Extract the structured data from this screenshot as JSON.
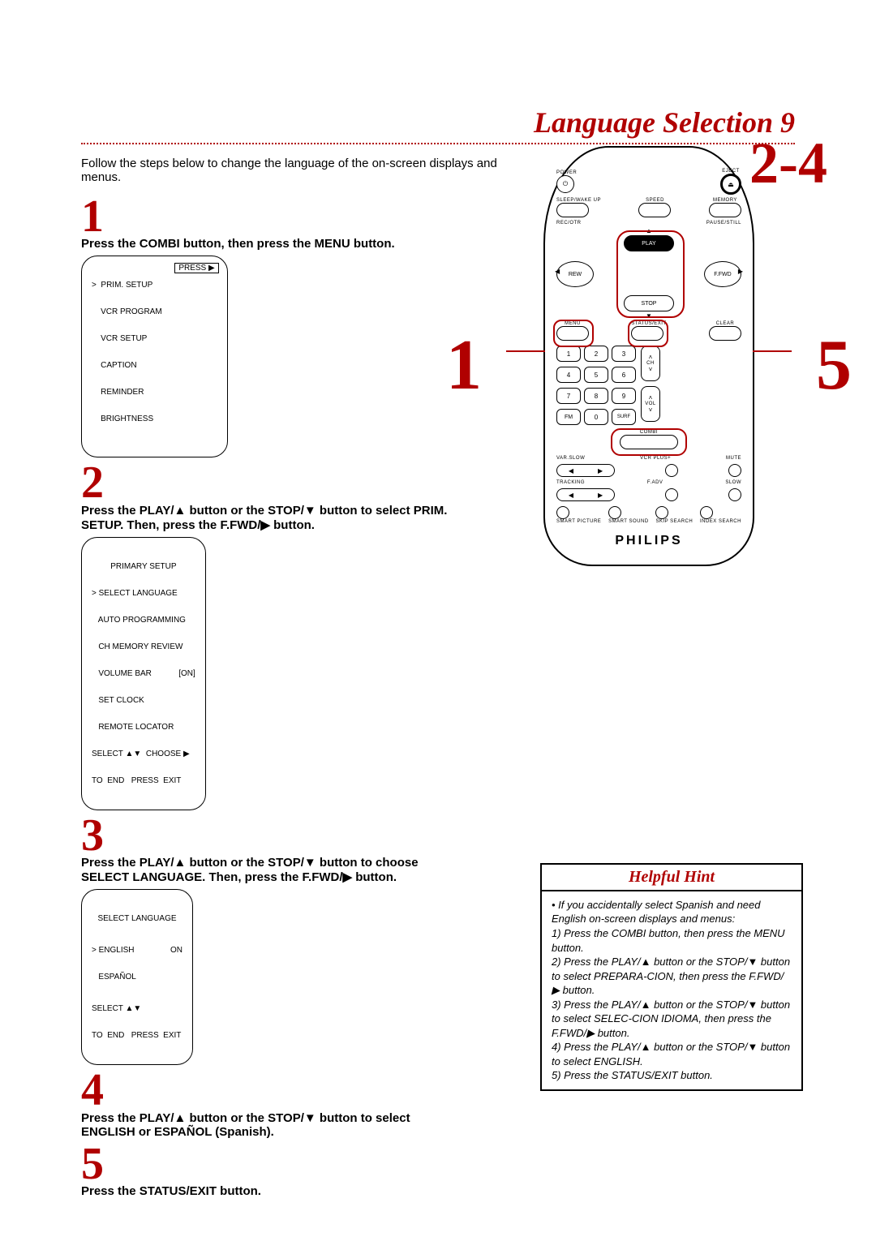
{
  "title": "Language Selection  9",
  "intro": "Follow the steps below to change the language of the on-screen displays and menus.",
  "steps": {
    "1": "Press the COMBI button, then press the MENU button.",
    "2": "Press the PLAY/▲ button or the STOP/▼ button to select PRIM. SETUP. Then, press the F.FWD/▶ button.",
    "3": "Press the PLAY/▲ button or the STOP/▼ button to choose SELECT LANGUAGE. Then, press the F.FWD/▶ button.",
    "4": "Press the PLAY/▲ button or the STOP/▼ button to select ENGLISH or ESPAÑOL (Spanish).",
    "5": "Press the STATUS/EXIT button."
  },
  "osd1": {
    "l1": ">  PRIM. SETUP",
    "l2": "    VCR PROGRAM",
    "l3": "    VCR SETUP",
    "l4": "    CAPTION",
    "l5": "    REMINDER",
    "l6": "    BRIGHTNESS",
    "press": "PRESS ▶"
  },
  "osd2": {
    "hdr": "PRIMARY SETUP",
    "l1": "> SELECT LANGUAGE",
    "l2": "   AUTO PROGRAMMING",
    "l3": "   CH MEMORY REVIEW",
    "l4": "   VOLUME BAR            [ON]",
    "l5": "   SET CLOCK",
    "l6": "   REMOTE LOCATOR",
    "f1": "SELECT ▲▼  CHOOSE ▶",
    "f2": "TO  END   PRESS  EXIT"
  },
  "osd3": {
    "hdr": "SELECT LANGUAGE",
    "l1": "> ENGLISH                ON",
    "l2": "   ESPAÑOL",
    "f1": "SELECT ▲▼",
    "f2": "TO  END   PRESS  EXIT"
  },
  "remote": {
    "brand": "PHILIPS",
    "power": "POWER",
    "eject": "EJECT",
    "eject_sym": "⏏",
    "sleep": "SLEEP/WAKE UP",
    "speed": "SPEED",
    "memory": "MEMORY",
    "recotr": "REC/OTR",
    "pausestill": "PAUSE/STILL",
    "play": "PLAY",
    "stop": "STOP",
    "rew": "REW",
    "ffwd": "F.FWD",
    "menu": "MENU",
    "statusexit": "STATUS/EXIT",
    "clear": "CLEAR",
    "fm": "FM",
    "surf": "SURF",
    "ch": "CH",
    "vol": "VOL",
    "combi": "COMBI",
    "varslow": "VAR.SLOW",
    "vcrplus": "VCR PLUS+",
    "mute": "MUTE",
    "tracking": "TRACKING",
    "fadv": "F.ADV",
    "slow": "SLOW",
    "smartpic": "SMART PICTURE",
    "smartsnd": "SMART SOUND",
    "skipsearch": "SKIP SEARCH",
    "indexsearch": "INDEX SEARCH",
    "keys": [
      "1",
      "2",
      "3",
      "4",
      "5",
      "6",
      "7",
      "8",
      "9",
      "0"
    ]
  },
  "callouts": {
    "left": "1",
    "right": "5",
    "topright": "2-4"
  },
  "hint": {
    "title": "Helpful Hint",
    "body": "• If you accidentally select Spanish and need English on-screen displays and menus:\n1) Press the COMBI button, then press the MENU button.\n2) Press the PLAY/▲ button or the STOP/▼ button to select PREPARA-CION, then press the F.FWD/▶ button.\n3) Press the PLAY/▲ button or the STOP/▼ button to select SELEC-CION IDIOMA, then press the F.FWD/▶ button.\n4) Press the PLAY/▲ button or the STOP/▼ button to select ENGLISH.\n5) Press the STATUS/EXIT button."
  }
}
